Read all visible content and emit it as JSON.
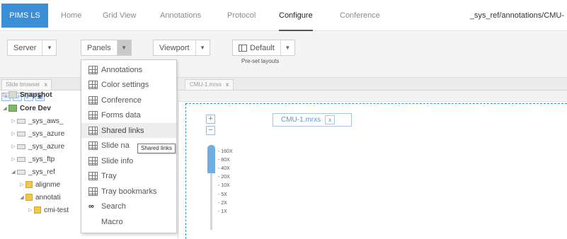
{
  "nav": {
    "logo": "PIMS LS",
    "tabs": [
      "Home",
      "Grid View",
      "Annotations",
      "Protocol",
      "Configure",
      "Conference"
    ],
    "active_tab": "Configure",
    "path": "_sys_ref/annotations/CMU-"
  },
  "toolbar": {
    "server_label": "Server",
    "panels_label": "Panels",
    "viewport_label": "Viewport",
    "default_label": "Default",
    "preset_layouts_label": "Pre-set layouts"
  },
  "panels_menu": {
    "items": [
      {
        "label": "Annotations",
        "icon": "annotations-icon"
      },
      {
        "label": "Color settings",
        "icon": "color-settings-icon"
      },
      {
        "label": "Conference",
        "icon": "conference-icon"
      },
      {
        "label": "Forms data",
        "icon": "forms-data-icon"
      },
      {
        "label": "Shared links",
        "icon": "shared-links-icon"
      },
      {
        "label": "Slide na",
        "icon": "slide-navigator-icon"
      },
      {
        "label": "Slide info",
        "icon": "slide-info-icon"
      },
      {
        "label": "Tray",
        "icon": "tray-icon"
      },
      {
        "label": "Tray bookmarks",
        "icon": "tray-bookmarks-icon"
      },
      {
        "label": "Search",
        "icon": "binoculars-icon"
      },
      {
        "label": "Macro",
        "icon": ""
      }
    ],
    "hovered": "Shared links",
    "tooltip": "Shared links"
  },
  "slide_browser": {
    "tab_label": "Slide browser",
    "close": "x",
    "tree": [
      {
        "label": "Snapshot",
        "level": 0,
        "icon": "gray",
        "bold": true,
        "expanded": false
      },
      {
        "label": "Core Dev",
        "level": 0,
        "icon": "green",
        "bold": true,
        "expanded": true
      },
      {
        "label": "_sys_aws_",
        "level": 1,
        "icon": "drive",
        "bold": false,
        "expanded": false
      },
      {
        "label": "_sys_azure",
        "level": 1,
        "icon": "drive",
        "bold": false,
        "expanded": false
      },
      {
        "label": "_sys_azure",
        "level": 1,
        "icon": "drive",
        "bold": false,
        "expanded": false
      },
      {
        "label": "_sys_ftp",
        "level": 1,
        "icon": "drive",
        "bold": false,
        "expanded": false
      },
      {
        "label": "_sys_ref",
        "level": 1,
        "icon": "drive",
        "bold": false,
        "expanded": true
      },
      {
        "label": "alignme",
        "level": 2,
        "icon": "folder",
        "bold": false,
        "expanded": false
      },
      {
        "label": "annotati",
        "level": 2,
        "icon": "folder",
        "bold": false,
        "expanded": true
      },
      {
        "label": "cmi-test",
        "level": 3,
        "icon": "folder",
        "bold": false,
        "expanded": false
      }
    ]
  },
  "viewer": {
    "tab_label": "CMU-1.mrxs",
    "close": "x",
    "slide_chip": "CMU-1.mrxs",
    "chip_close": "x",
    "zoom_in": "+",
    "zoom_out": "−",
    "zoom_levels": [
      "- 160X",
      "- 80X",
      "- 40X",
      "- 20X",
      "- 10X",
      "- 5X",
      "- 2X",
      "- 1X"
    ],
    "zoom_fill_fraction": 0.33
  }
}
